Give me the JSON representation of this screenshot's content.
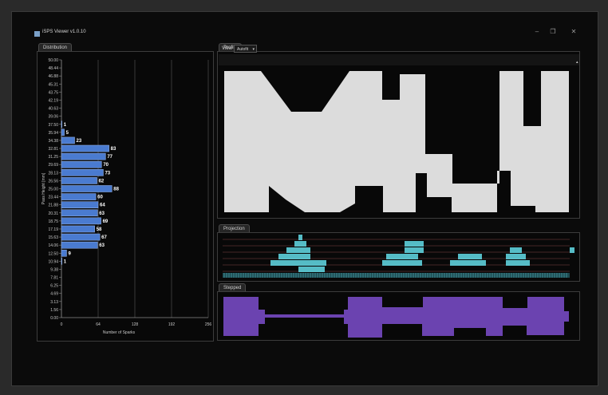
{
  "window": {
    "title": "iSPS Viewer v1.0.10",
    "minimize": "–",
    "maximize": "❐",
    "close": "✕"
  },
  "tabs": {
    "distribution": "Distribution",
    "profile": "Profile",
    "projection": "Projection",
    "stepped": "Stepped"
  },
  "view_control": {
    "label": "View",
    "selected": "Autofit",
    "chevron": "▾"
  },
  "colors": {
    "bar": "#4a7bd0",
    "bar_border": "#9bb8ec",
    "profile": "#dcdcdc",
    "projection": "#5ed0dc",
    "stepped": "#6b43b0"
  },
  "chart_data": {
    "type": "bar",
    "orientation": "horizontal",
    "xlabel": "Number of Sparks",
    "ylabel": "Pass Height [mm]",
    "x_ticks": [
      "0",
      "64",
      "128",
      "192",
      "256"
    ],
    "xlim": [
      0,
      256
    ],
    "y_ticks": [
      "50.00",
      "48.44",
      "46.88",
      "45.31",
      "43.75",
      "42.19",
      "40.63",
      "39.06",
      "37.50",
      "35.94",
      "34.38",
      "32.81",
      "31.25",
      "29.69",
      "28.13",
      "26.56",
      "25.00",
      "23.44",
      "21.88",
      "20.31",
      "18.75",
      "17.19",
      "15.63",
      "14.06",
      "12.50",
      "10.94",
      "9.38",
      "7.81",
      "6.25",
      "4.69",
      "3.13",
      "1.56",
      "0.00"
    ],
    "values": [
      0,
      0,
      0,
      0,
      0,
      0,
      0,
      0,
      1,
      5,
      23,
      83,
      77,
      70,
      73,
      62,
      88,
      60,
      64,
      63,
      69,
      58,
      67,
      63,
      9,
      1,
      0,
      0,
      0,
      0,
      0,
      0,
      0
    ],
    "labels": [
      "",
      "",
      "",
      "",
      "",
      "",
      "",
      "",
      "1",
      "5",
      "23",
      "83",
      "77",
      "70",
      "73",
      "62",
      "88",
      "60",
      "64",
      "63",
      "69",
      "58",
      "67",
      "63",
      "9",
      "1",
      "",
      "",
      "",
      "",
      "",
      "",
      ""
    ]
  }
}
